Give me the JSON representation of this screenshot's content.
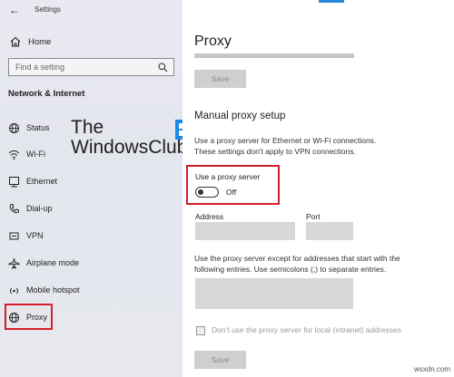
{
  "window": {
    "title": "Settings"
  },
  "sidebar": {
    "home_label": "Home",
    "search_placeholder": "Find a setting",
    "section_title": "Network & Internet",
    "items": [
      {
        "label": "Status",
        "icon": "globe-icon"
      },
      {
        "label": "Wi-Fi",
        "icon": "wifi-icon"
      },
      {
        "label": "Ethernet",
        "icon": "ethernet-icon"
      },
      {
        "label": "Dial-up",
        "icon": "phone-icon"
      },
      {
        "label": "VPN",
        "icon": "vpn-icon"
      },
      {
        "label": "Airplane mode",
        "icon": "airplane-icon"
      },
      {
        "label": "Mobile hotspot",
        "icon": "hotspot-icon"
      },
      {
        "label": "Proxy",
        "icon": "globe-icon"
      }
    ]
  },
  "watermark": {
    "line1": "The",
    "line2": "WindowsClub"
  },
  "main": {
    "page_title": "Proxy",
    "save_label_top": "Save",
    "manual_title": "Manual proxy setup",
    "manual_desc": "Use a proxy server for Ethernet or Wi-Fi connections. These settings don't apply to VPN connections.",
    "use_proxy_label": "Use a proxy server",
    "toggle_state": "Off",
    "address_label": "Address",
    "port_label": "Port",
    "exceptions_desc": "Use the proxy server except for addresses that start with the following entries. Use semicolons (;) to separate entries.",
    "local_label": "Don't use the proxy server for local (intranet) addresses",
    "save_label_bottom": "Save"
  },
  "footer": {
    "site": "wsxdn.com"
  },
  "colors": {
    "highlight": "#d21f2a",
    "accent": "#2b88d8"
  }
}
